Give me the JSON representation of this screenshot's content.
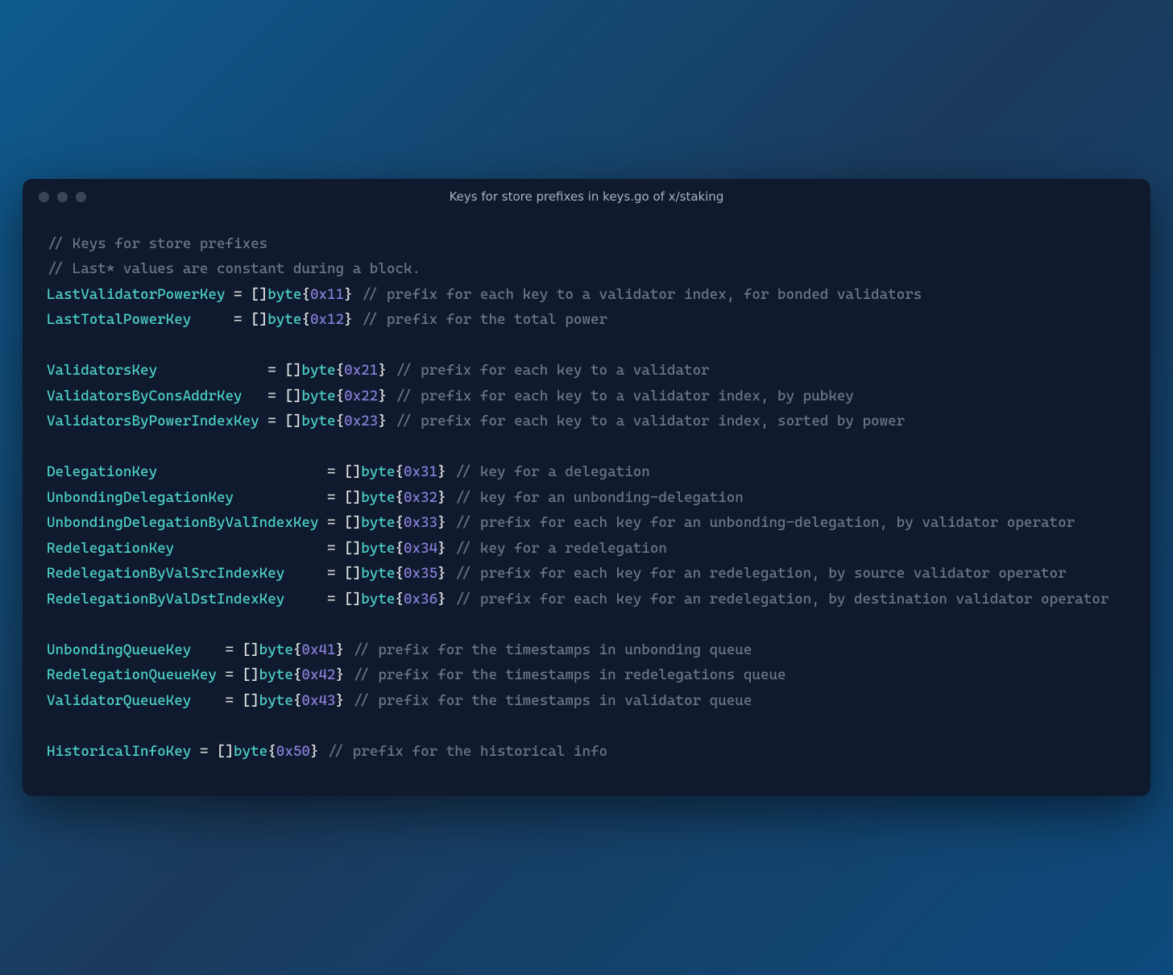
{
  "title": "Keys for store prefixes in keys.go of x/staking",
  "code": {
    "c1": "// Keys for store prefixes",
    "c2": "// Last* values are constant during a block.",
    "g1": [
      {
        "name": "LastValidatorPowerKey",
        "namePad": "LastValidatorPowerKey",
        "hex": "0x11",
        "comment": "// prefix for each key to a validator index, for bonded validators"
      },
      {
        "name": "LastTotalPowerKey",
        "namePad": "LastTotalPowerKey    ",
        "hex": "0x12",
        "comment": "// prefix for the total power"
      }
    ],
    "g2": [
      {
        "name": "ValidatorsKey",
        "namePad": "ValidatorsKey            ",
        "hex": "0x21",
        "comment": "// prefix for each key to a validator"
      },
      {
        "name": "ValidatorsByConsAddrKey",
        "namePad": "ValidatorsByConsAddrKey  ",
        "hex": "0x22",
        "comment": "// prefix for each key to a validator index, by pubkey"
      },
      {
        "name": "ValidatorsByPowerIndexKey",
        "namePad": "ValidatorsByPowerIndexKey",
        "hex": "0x23",
        "comment": "// prefix for each key to a validator index, sorted by power"
      }
    ],
    "g3": [
      {
        "name": "DelegationKey",
        "namePad": "DelegationKey                   ",
        "hex": "0x31",
        "comment": "// key for a delegation"
      },
      {
        "name": "UnbondingDelegationKey",
        "namePad": "UnbondingDelegationKey          ",
        "hex": "0x32",
        "comment": "// key for an unbonding-delegation"
      },
      {
        "name": "UnbondingDelegationByValIndexKey",
        "namePad": "UnbondingDelegationByValIndexKey",
        "hex": "0x33",
        "comment": "// prefix for each key for an unbonding-delegation, by validator operator"
      },
      {
        "name": "RedelegationKey",
        "namePad": "RedelegationKey                 ",
        "hex": "0x34",
        "comment": "// key for a redelegation"
      },
      {
        "name": "RedelegationByValSrcIndexKey",
        "namePad": "RedelegationByValSrcIndexKey    ",
        "hex": "0x35",
        "comment": "// prefix for each key for an redelegation, by source validator operator"
      },
      {
        "name": "RedelegationByValDstIndexKey",
        "namePad": "RedelegationByValDstIndexKey    ",
        "hex": "0x36",
        "comment": "// prefix for each key for an redelegation, by destination validator operator"
      }
    ],
    "g4": [
      {
        "name": "UnbondingQueueKey",
        "namePad": "UnbondingQueueKey   ",
        "hex": "0x41",
        "comment": "// prefix for the timestamps in unbonding queue"
      },
      {
        "name": "RedelegationQueueKey",
        "namePad": "RedelegationQueueKey",
        "hex": "0x42",
        "comment": "// prefix for the timestamps in redelegations queue"
      },
      {
        "name": "ValidatorQueueKey",
        "namePad": "ValidatorQueueKey   ",
        "hex": "0x43",
        "comment": "// prefix for the timestamps in validator queue"
      }
    ],
    "g5": [
      {
        "name": "HistoricalInfoKey",
        "namePad": "HistoricalInfoKey",
        "hex": "0x50",
        "comment": "// prefix for the historical info"
      }
    ],
    "byteKw": "byte"
  }
}
